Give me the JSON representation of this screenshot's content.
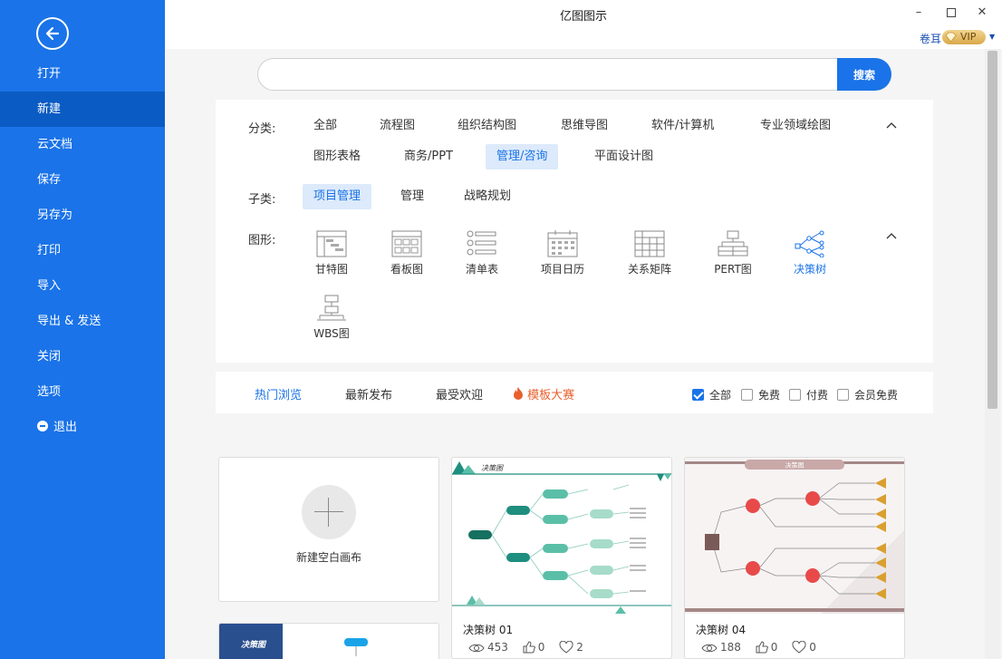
{
  "app": {
    "title": "亿图图示",
    "user": "卷耳",
    "vip": "VIP"
  },
  "colors": {
    "sidebar": "#1a73e8",
    "accent": "#1a73e8",
    "contest": "#e8602c"
  },
  "sidebar": {
    "items": [
      {
        "label": "打开"
      },
      {
        "label": "新建",
        "active": true
      },
      {
        "label": "云文档"
      },
      {
        "label": "保存"
      },
      {
        "label": "另存为"
      },
      {
        "label": "打印"
      },
      {
        "label": "导入"
      },
      {
        "label": "导出 & 发送"
      },
      {
        "label": "关闭"
      },
      {
        "label": "选项"
      },
      {
        "label": "退出"
      }
    ]
  },
  "search": {
    "value": "",
    "placeholder": "",
    "button": "搜索"
  },
  "filters": {
    "category_label": "分类:",
    "categories": [
      "全部",
      "流程图",
      "组织结构图",
      "思维导图",
      "软件/计算机",
      "专业领域绘图",
      "图形表格",
      "商务/PPT",
      "管理/咨询",
      "平面设计图"
    ],
    "category_active": "管理/咨询",
    "subcategory_label": "子类:",
    "subcategories": [
      "项目管理",
      "管理",
      "战略规划"
    ],
    "subcategory_active": "项目管理",
    "shape_label": "图形:",
    "shapes": [
      "甘特图",
      "看板图",
      "清单表",
      "项目日历",
      "关系矩阵",
      "PERT图",
      "决策树",
      "WBS图"
    ],
    "shape_active": "决策树"
  },
  "tabs": {
    "items": [
      "热门浏览",
      "最新发布",
      "最受欢迎",
      "模板大赛"
    ],
    "active": "热门浏览",
    "price_filters": [
      {
        "label": "全部",
        "checked": true
      },
      {
        "label": "免费",
        "checked": false
      },
      {
        "label": "付费",
        "checked": false
      },
      {
        "label": "会员免费",
        "checked": false
      }
    ]
  },
  "cards": {
    "new_blank": "新建空白画布",
    "templates": [
      {
        "title": "决策树 01",
        "views": "453",
        "likes": "0",
        "favorites": "2",
        "thumb_heading": "决策图"
      },
      {
        "title": "决策树 04",
        "views": "188",
        "likes": "0",
        "favorites": "0",
        "thumb_heading": "决策图"
      }
    ],
    "partial_heading": "决策图"
  }
}
